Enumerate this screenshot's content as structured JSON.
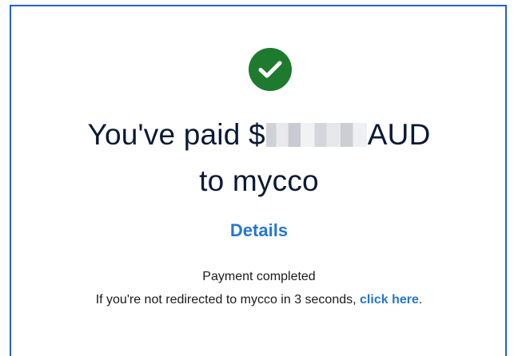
{
  "confirmation": {
    "icon": "check-circle-icon",
    "headline_prefix": "You've paid $",
    "headline_suffix": "AUD",
    "headline_line2": "to mycco",
    "details_link": "Details",
    "status_text": "Payment completed",
    "redirect_prefix": "If you're not redirected to mycco in 3 seconds,",
    "redirect_link": "click here",
    "redirect_suffix": ".",
    "colors": {
      "success_green": "#1d7a2e",
      "link_blue": "#2476d4",
      "headline_navy": "#0b1a33",
      "frame_border": "#1f5fd6"
    }
  }
}
